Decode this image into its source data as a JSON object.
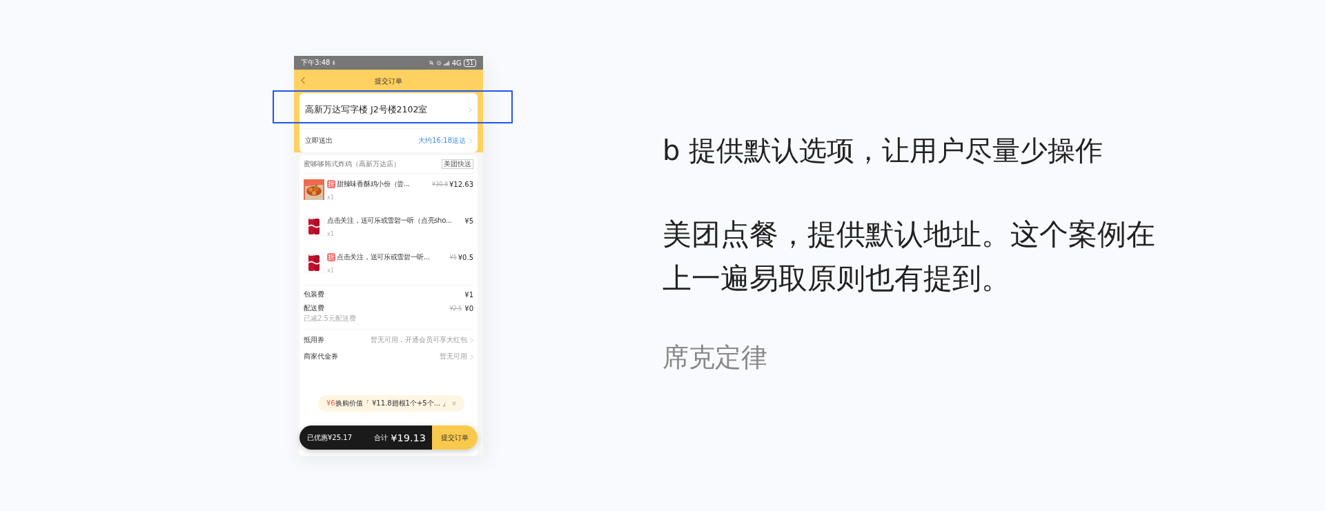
{
  "phone": {
    "status_bar": {
      "time": "下午3:48",
      "network": "4G",
      "battery": "51"
    },
    "header": {
      "title": "提交订单"
    },
    "address": {
      "text": "高新万达写字楼 J2号楼2102室"
    },
    "delivery": {
      "label": "立即送出",
      "value": "大约16:18送达"
    },
    "shop": {
      "name": "蜜哆哆韩式炸鸡（高新万达店）",
      "badge": "美团快送"
    },
    "items": [
      {
        "kind": "chicken",
        "discount": "折",
        "name": "甜辣味香酥鸡小份（尝...",
        "original_price": "¥30.8",
        "price": "¥12.63",
        "quantity": "x1"
      },
      {
        "kind": "can",
        "name": "点击关注，送可乐或雪碧一听（点亮sho...",
        "price": "¥5",
        "quantity": "x1"
      },
      {
        "kind": "can",
        "discount": "折",
        "name": "点击关注，送可乐或雪碧一听...",
        "original_price": "¥5",
        "price": "¥0.5",
        "quantity": "x1"
      }
    ],
    "fees": [
      {
        "label": "包装费",
        "price": "¥1"
      },
      {
        "label": "配送费",
        "original_price": "¥2.5",
        "price": "¥0",
        "note": "已减2.5元配送费"
      }
    ],
    "coupons": [
      {
        "label": "抵用券",
        "value": "暂无可用，开通会员可享大红包"
      },
      {
        "label": "商家代金券",
        "value": "暂无可用"
      }
    ],
    "promo": {
      "price": "¥6",
      "text": "换购价值「 ¥11.8翅根1个+5个...  」"
    },
    "bottom_bar": {
      "saved": "已优惠¥25.17",
      "total_label": "合计",
      "total": "¥19.13",
      "submit": "提交订单"
    }
  },
  "title": "b 提供默认选项，让用户尽量少操作",
  "body": "美团点餐，提供默认地址。这个案例在上一遍易取原则也有提到。",
  "caption": "席克定律"
}
